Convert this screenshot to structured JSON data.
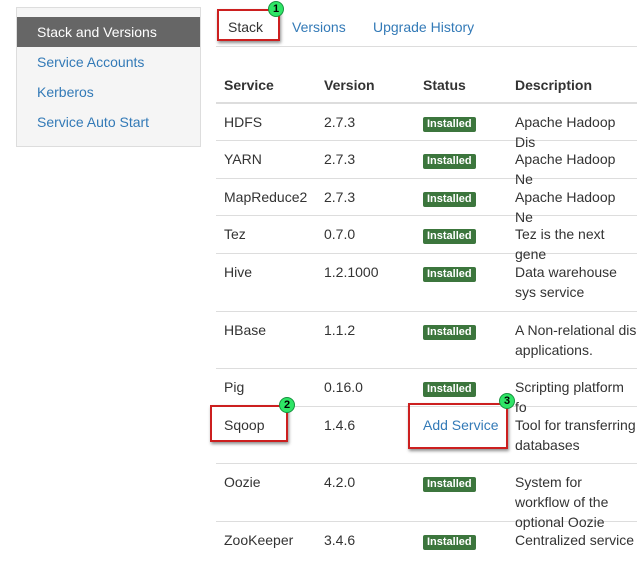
{
  "sidebar": {
    "items": [
      {
        "label": "Stack and Versions",
        "active": true
      },
      {
        "label": "Service Accounts"
      },
      {
        "label": "Kerberos"
      },
      {
        "label": "Service Auto Start"
      }
    ]
  },
  "tabs": [
    {
      "label": "Stack",
      "active": true
    },
    {
      "label": "Versions"
    },
    {
      "label": "Upgrade History"
    }
  ],
  "markers": [
    "1",
    "2",
    "3"
  ],
  "table": {
    "headers": {
      "service": "Service",
      "version": "Version",
      "status": "Status",
      "description": "Description"
    },
    "rows": [
      {
        "service": "HDFS",
        "version": "2.7.3",
        "status": "Installed",
        "description": "Apache Hadoop Dis"
      },
      {
        "service": "YARN",
        "version": "2.7.3",
        "status": "Installed",
        "description": "Apache Hadoop Ne"
      },
      {
        "service": "MapReduce2",
        "version": "2.7.3",
        "status": "Installed",
        "description": "Apache Hadoop Ne"
      },
      {
        "service": "Tez",
        "version": "0.7.0",
        "status": "Installed",
        "description": "Tez is the next gene"
      },
      {
        "service": "Hive",
        "version": "1.2.1000",
        "status": "Installed",
        "description": "Data warehouse sys service"
      },
      {
        "service": "HBase",
        "version": "1.1.2",
        "status": "Installed",
        "description": "A Non-relational dis applications."
      },
      {
        "service": "Pig",
        "version": "0.16.0",
        "status": "Installed",
        "description": "Scripting platform fo"
      },
      {
        "service": "Sqoop",
        "version": "1.4.6",
        "action": "Add Service",
        "description": "Tool for transferring databases"
      },
      {
        "service": "Oozie",
        "version": "4.2.0",
        "status": "Installed",
        "description": "System for workflow of the optional Oozie"
      },
      {
        "service": "ZooKeeper",
        "version": "3.4.6",
        "status": "Installed",
        "description": "Centralized service"
      }
    ]
  },
  "colors": {
    "accent": "#337ab7",
    "installed_badge": "#3c763d",
    "sidebar_active": "#666666",
    "highlight": "#cc1f1f",
    "marker": "#2ee566"
  }
}
